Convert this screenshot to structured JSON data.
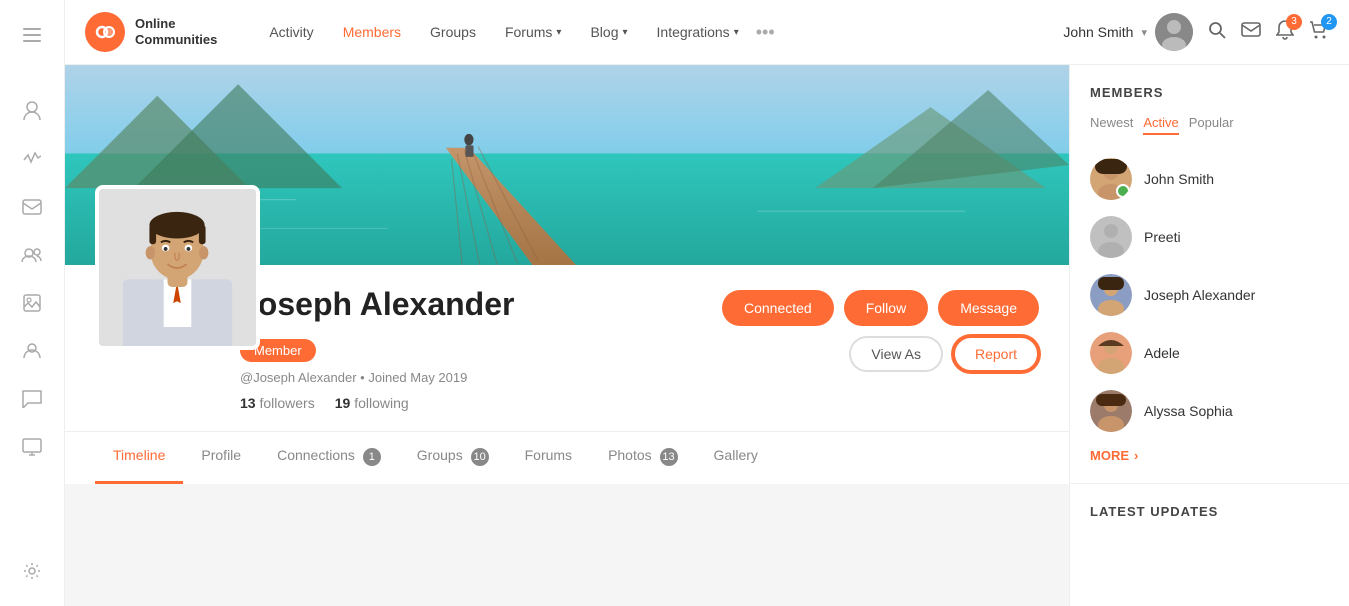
{
  "brand": {
    "logo_text": "bc",
    "name_line1": "Online",
    "name_line2": "Communities"
  },
  "navbar": {
    "links": [
      {
        "label": "Activity",
        "active": false
      },
      {
        "label": "Members",
        "active": true
      },
      {
        "label": "Groups",
        "active": false
      },
      {
        "label": "Forums",
        "active": false,
        "has_arrow": true
      },
      {
        "label": "Blog",
        "active": false,
        "has_arrow": true
      },
      {
        "label": "Integrations",
        "active": false,
        "has_arrow": true
      }
    ],
    "more_label": "•••",
    "user_name": "John Smith",
    "notification_count": "3",
    "cart_count": "2"
  },
  "profile": {
    "name": "Joseph Alexander",
    "username": "@Joseph Alexander",
    "joined": "Joined May 2019",
    "member_badge": "Member",
    "followers_count": "13",
    "followers_label": "followers",
    "following_count": "19",
    "following_label": "following",
    "buttons": {
      "connected": "Connected",
      "follow": "Follow",
      "message": "Message",
      "view_as": "View As",
      "report": "Report"
    }
  },
  "tabs": [
    {
      "label": "Timeline",
      "active": true,
      "badge": null
    },
    {
      "label": "Profile",
      "active": false,
      "badge": null
    },
    {
      "label": "Connections",
      "active": false,
      "badge": "1"
    },
    {
      "label": "Groups",
      "active": false,
      "badge": "10"
    },
    {
      "label": "Forums",
      "active": false,
      "badge": null
    },
    {
      "label": "Photos",
      "active": false,
      "badge": "13"
    },
    {
      "label": "Gallery",
      "active": false,
      "badge": null
    }
  ],
  "members_sidebar": {
    "title": "MEMBERS",
    "filter_tabs": [
      {
        "label": "Newest",
        "active": false
      },
      {
        "label": "Active",
        "active": true
      },
      {
        "label": "Popular",
        "active": false
      }
    ],
    "members": [
      {
        "name": "John Smith",
        "has_online": true,
        "avatar_class": "av1"
      },
      {
        "name": "Preeti",
        "has_online": false,
        "avatar_class": "av2"
      },
      {
        "name": "Joseph Alexander",
        "has_online": false,
        "avatar_class": "av3"
      },
      {
        "name": "Adele",
        "has_online": false,
        "avatar_class": "av4"
      },
      {
        "name": "Alyssa Sophia",
        "has_online": false,
        "avatar_class": "av5"
      }
    ],
    "more_label": "MORE",
    "latest_updates_title": "LATEST UPDATES"
  },
  "sidebar_icons": [
    {
      "icon": "☰",
      "name": "menu-icon"
    },
    {
      "icon": "👤",
      "name": "profile-icon"
    },
    {
      "icon": "📈",
      "name": "activity-icon"
    },
    {
      "icon": "✉",
      "name": "messages-icon"
    },
    {
      "icon": "👥",
      "name": "groups-icon"
    },
    {
      "icon": "🖼",
      "name": "media-icon"
    },
    {
      "icon": "👤",
      "name": "connections-icon"
    },
    {
      "icon": "💬",
      "name": "chat-icon"
    },
    {
      "icon": "🖥",
      "name": "screen-icon"
    }
  ]
}
